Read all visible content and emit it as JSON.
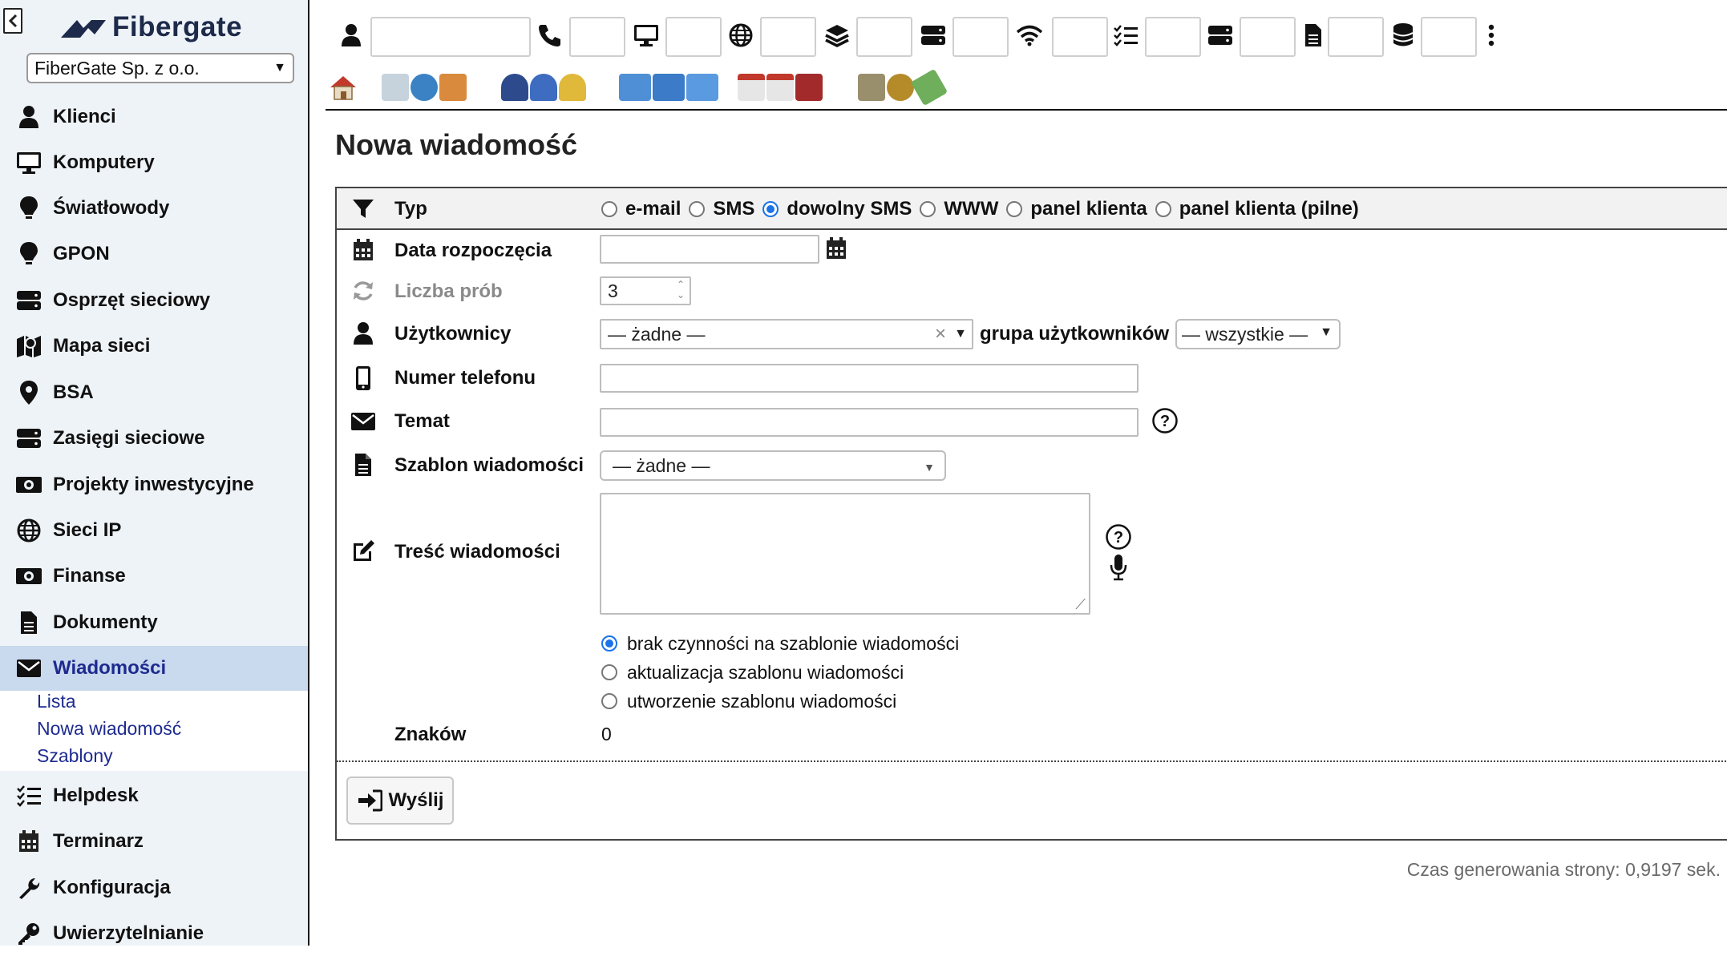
{
  "app": {
    "brand": "Fibergate",
    "company": "FiberGate Sp. z o.o."
  },
  "sidebar": {
    "items": [
      {
        "label": "Klienci",
        "icon": "user-icon"
      },
      {
        "label": "Komputery",
        "icon": "monitor-icon"
      },
      {
        "label": "Światłowody",
        "icon": "lightbulb-icon"
      },
      {
        "label": "GPON",
        "icon": "lightbulb-icon"
      },
      {
        "label": "Osprzęt sieciowy",
        "icon": "server-icon"
      },
      {
        "label": "Mapa sieci",
        "icon": "map-icon"
      },
      {
        "label": "BSA",
        "icon": "map-pin-icon"
      },
      {
        "label": "Zasięgi sieciowe",
        "icon": "server-icon"
      },
      {
        "label": "Projekty inwestycyjne",
        "icon": "money-icon"
      },
      {
        "label": "Sieci IP",
        "icon": "globe-icon"
      },
      {
        "label": "Finanse",
        "icon": "money-icon"
      },
      {
        "label": "Dokumenty",
        "icon": "document-icon"
      },
      {
        "label": "Wiadomości",
        "icon": "envelope-icon",
        "active": true
      },
      {
        "label": "Helpdesk",
        "icon": "checklist-icon"
      },
      {
        "label": "Terminarz",
        "icon": "calendar-icon"
      },
      {
        "label": "Konfiguracja",
        "icon": "wrench-icon"
      },
      {
        "label": "Uwierzytelnianie",
        "icon": "key-icon"
      }
    ],
    "submenu": [
      "Lista",
      "Nowa wiadomość",
      "Szablony"
    ]
  },
  "toolbar": {
    "search_fields": [
      {
        "icon": "user-icon",
        "value": ""
      },
      {
        "icon": "phone-icon",
        "value": ""
      },
      {
        "icon": "monitor-icon",
        "value": ""
      },
      {
        "icon": "globe-icon",
        "value": ""
      },
      {
        "icon": "layers-icon",
        "value": ""
      },
      {
        "icon": "server-icon",
        "value": ""
      },
      {
        "icon": "wifi-icon",
        "value": ""
      },
      {
        "icon": "checklist-icon",
        "value": ""
      },
      {
        "icon": "server-icon",
        "value": ""
      },
      {
        "icon": "document-icon",
        "value": ""
      },
      {
        "icon": "database-icon",
        "value": ""
      }
    ],
    "quick_actions": [
      "home-icon",
      "add-network-icon",
      "add-customer-icon",
      "add-computer-icon",
      "calendar-add-icon",
      "finance-icon"
    ]
  },
  "page": {
    "title": "Nowa wiadomość"
  },
  "form": {
    "type": {
      "label": "Typ",
      "options": [
        {
          "label": "e-mail",
          "checked": false
        },
        {
          "label": "SMS",
          "checked": false
        },
        {
          "label": "dowolny SMS",
          "checked": true
        },
        {
          "label": "WWW",
          "checked": false
        },
        {
          "label": "panel klienta",
          "checked": false
        },
        {
          "label": "panel klienta (pilne)",
          "checked": false
        }
      ]
    },
    "start_date": {
      "label": "Data rozpoczęcia",
      "value": ""
    },
    "attempts": {
      "label": "Liczba prób",
      "value": "3"
    },
    "users": {
      "label": "Użytkownicy",
      "value": "— żadne —",
      "group_label": "grupa użytkowników",
      "group_value": "— wszystkie —"
    },
    "phone": {
      "label": "Numer telefonu",
      "value": ""
    },
    "subject": {
      "label": "Temat",
      "value": ""
    },
    "template": {
      "label": "Szablon wiadomości",
      "value": "— żadne —"
    },
    "body": {
      "label": "Treść wiadomości",
      "value": ""
    },
    "template_actions": [
      {
        "label": "brak czynności na szablonie wiadomości",
        "checked": true
      },
      {
        "label": "aktualizacja szablonu wiadomości",
        "checked": false
      },
      {
        "label": "utworzenie szablonu wiadomości",
        "checked": false
      }
    ],
    "char_count": {
      "label": "Znaków",
      "value": "0"
    },
    "submit_label": "Wyślij"
  },
  "footer": {
    "generation_time": "Czas generowania strony: 0,9197 sek."
  },
  "colors": {
    "accent": "#1a73e8",
    "active_nav_bg": "#c9d9ee",
    "sidebar_bg": "#eef3f8"
  }
}
